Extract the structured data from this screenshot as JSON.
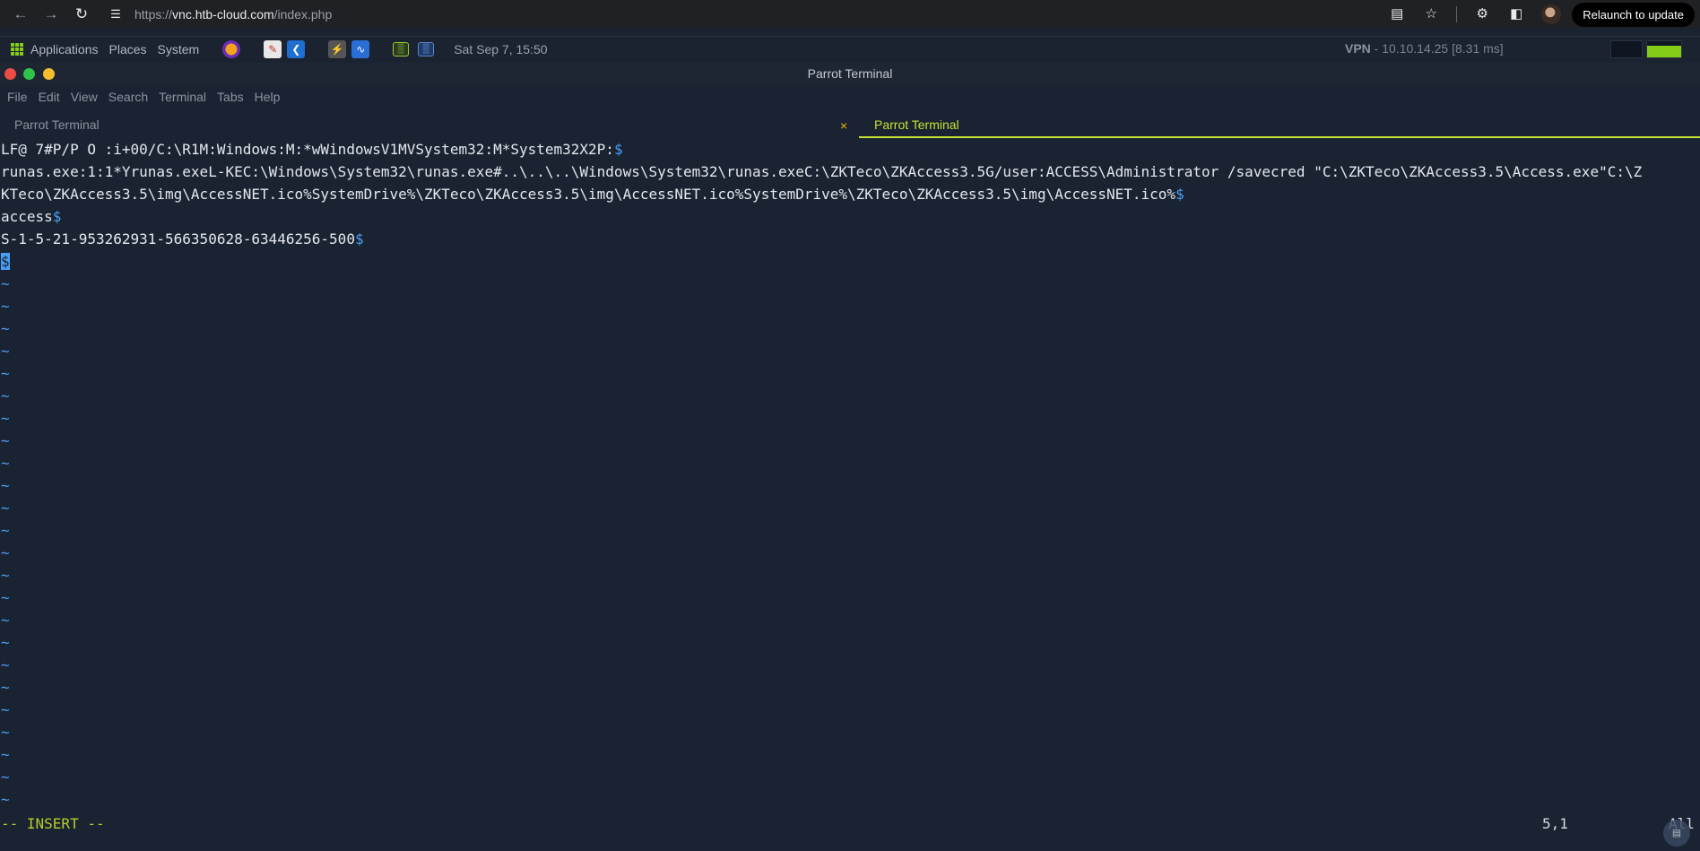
{
  "browser": {
    "url_prefix": "https://",
    "url_host": "vnc.htb-cloud.com",
    "url_path": "/index.php",
    "relaunch_label": "Relaunch to update"
  },
  "panel": {
    "menu": [
      "Applications",
      "Places",
      "System"
    ],
    "clock": "Sat Sep 7, 15:50",
    "vpn_label": "VPN",
    "vpn_value": " - 10.10.14.25 [8.31 ms]"
  },
  "window": {
    "title": "Parrot Terminal",
    "menu": [
      "File",
      "Edit",
      "View",
      "Search",
      "Terminal",
      "Tabs",
      "Help"
    ],
    "tabs": [
      "Parrot Terminal",
      "Parrot Terminal"
    ],
    "tab_close": "×"
  },
  "terminal": {
    "lines": [
      "LF@ 7#P/P O :i+00/C:\\R1M:Windows:M:*wWindowsV1MVSystem32:M*System32X2P:",
      "runas.exe:1:1*Yrunas.exeL-KEC:\\Windows\\System32\\runas.exe#..\\..\\..\\Windows\\System32\\runas.exeC:\\ZKTeco\\ZKAccess3.5G/user:ACCESS\\Administrator /savecred \"C:\\ZKTeco\\ZKAccess3.5\\Access.exe\"C:\\Z",
      "KTeco\\ZKAccess3.5\\img\\AccessNET.ico%SystemDrive%\\ZKTeco\\ZKAccess3.5\\img\\AccessNET.ico%SystemDrive%\\ZKTeco\\ZKAccess3.5\\img\\AccessNET.ico%",
      "access",
      "S-1-5-21-953262931-566350628-63446256-500"
    ],
    "line_end": "$",
    "cursor_char": "$",
    "tilde": "~",
    "mode": "-- INSERT --",
    "position": "5,1",
    "scroll": "All"
  },
  "colors": {
    "accent": "#c7e032",
    "dollar": "#4a9ff5",
    "background": "#1a2332"
  }
}
